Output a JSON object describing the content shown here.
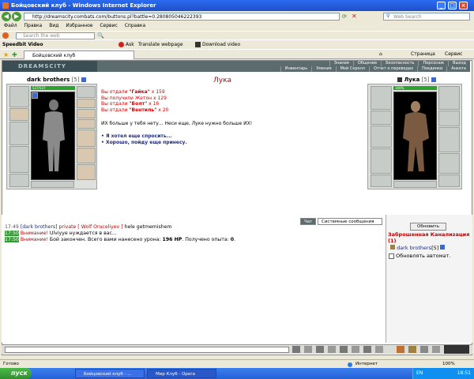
{
  "window": {
    "title": "Бойцовский клуб - Windows Internet Explorer",
    "url": "http://dreamscity.combats.com/buttons.pl?battle=0.280805046222393",
    "search_placeholder": "Web Search"
  },
  "menu": [
    "Файл",
    "Правка",
    "Вид",
    "Избранное",
    "Сервис",
    "Справка"
  ],
  "toolbar1": {
    "search_placeholder": "Search the web",
    "toolbar_label": "Speedbit Video",
    "ask_label": "Ask",
    "translate_label": "Translate webpage",
    "download_label": "Download video"
  },
  "toolbar2": {
    "page_label": "Страница",
    "service_label": "Сервис"
  },
  "browser_tab": {
    "label": "Бойцовский клуб"
  },
  "game": {
    "logo": "DREAMSCITY",
    "nav_row1": [
      "Знания",
      "Общение",
      "Безопасность",
      "Персонаж",
      "Выход"
    ],
    "nav_row2": [
      "Инвентарь",
      "Умения",
      "Мой Скролл",
      "Отчет о переводах",
      "Поединки",
      "Анкета"
    ],
    "player": {
      "name": "dark brothers",
      "level": "[5]",
      "hp_label": "537/537",
      "hp_fraction": 1.0
    },
    "npc": {
      "name": "Лука",
      "level": "[5]",
      "hp_label": "100%",
      "hp_fraction": 1.0
    },
    "dialog": {
      "title": "Лука",
      "lines": [
        {
          "pre": "Вы отдали ",
          "item": "\"Гайка\"",
          "post": " x 159"
        },
        {
          "pre": "Вы получили Жетон ",
          "item": "",
          "post": "x 129"
        },
        {
          "pre": "Вы отдали ",
          "item": "\"Болт\"",
          "post": " x 16"
        },
        {
          "pre": "Вы отдали ",
          "item": "\"Вентиль\"",
          "post": " x 20"
        }
      ],
      "text": "ИХ больше у тебя нету... Неси еще, Луке нужно больше ИХ!",
      "options": [
        "Я хотел еще спросить...",
        "Хорошо, пойду еще принесу."
      ]
    },
    "chat": {
      "tabs": [
        "Чат",
        "Системные сообщения"
      ],
      "messages": [
        {
          "time": "17:49",
          "sender": "[dark brothers]",
          "private_label": "private [ Wolf Oruceliyev ]",
          "text": "hele getmemishem"
        },
        {
          "time": "17:50",
          "warn": "Внимание!",
          "text": "Ulviyye нуждается в вас..."
        },
        {
          "time": "17:50",
          "warn": "Внимание!",
          "text": "Бой закончен. Всего вами нанесено урона: ",
          "bold1": "196 HP",
          "text2": ". Получено опыта: ",
          "bold2": "0",
          "text3": "."
        }
      ]
    },
    "location": {
      "refresh_button": "Обновить",
      "name": "Заброшенная Канализация",
      "count": "(1)",
      "online_user": "dark brothers",
      "online_level": "[5]",
      "auto_refresh_label": "Обновлять автомат."
    }
  },
  "status": {
    "left": "Готово",
    "zone": "Интернет",
    "zoom": "100%"
  },
  "taskbar": {
    "start": "пуск",
    "tasks": [
      "Бойцовский клуб - ...",
      "Мир Клуб - Opera"
    ],
    "lang": "EN",
    "time": "18:51"
  },
  "colors": {
    "dialog_red": "#c00000",
    "item_red": "#e02020",
    "hp_green": "#2fa02f",
    "logo_bg": "#3a4e54"
  }
}
